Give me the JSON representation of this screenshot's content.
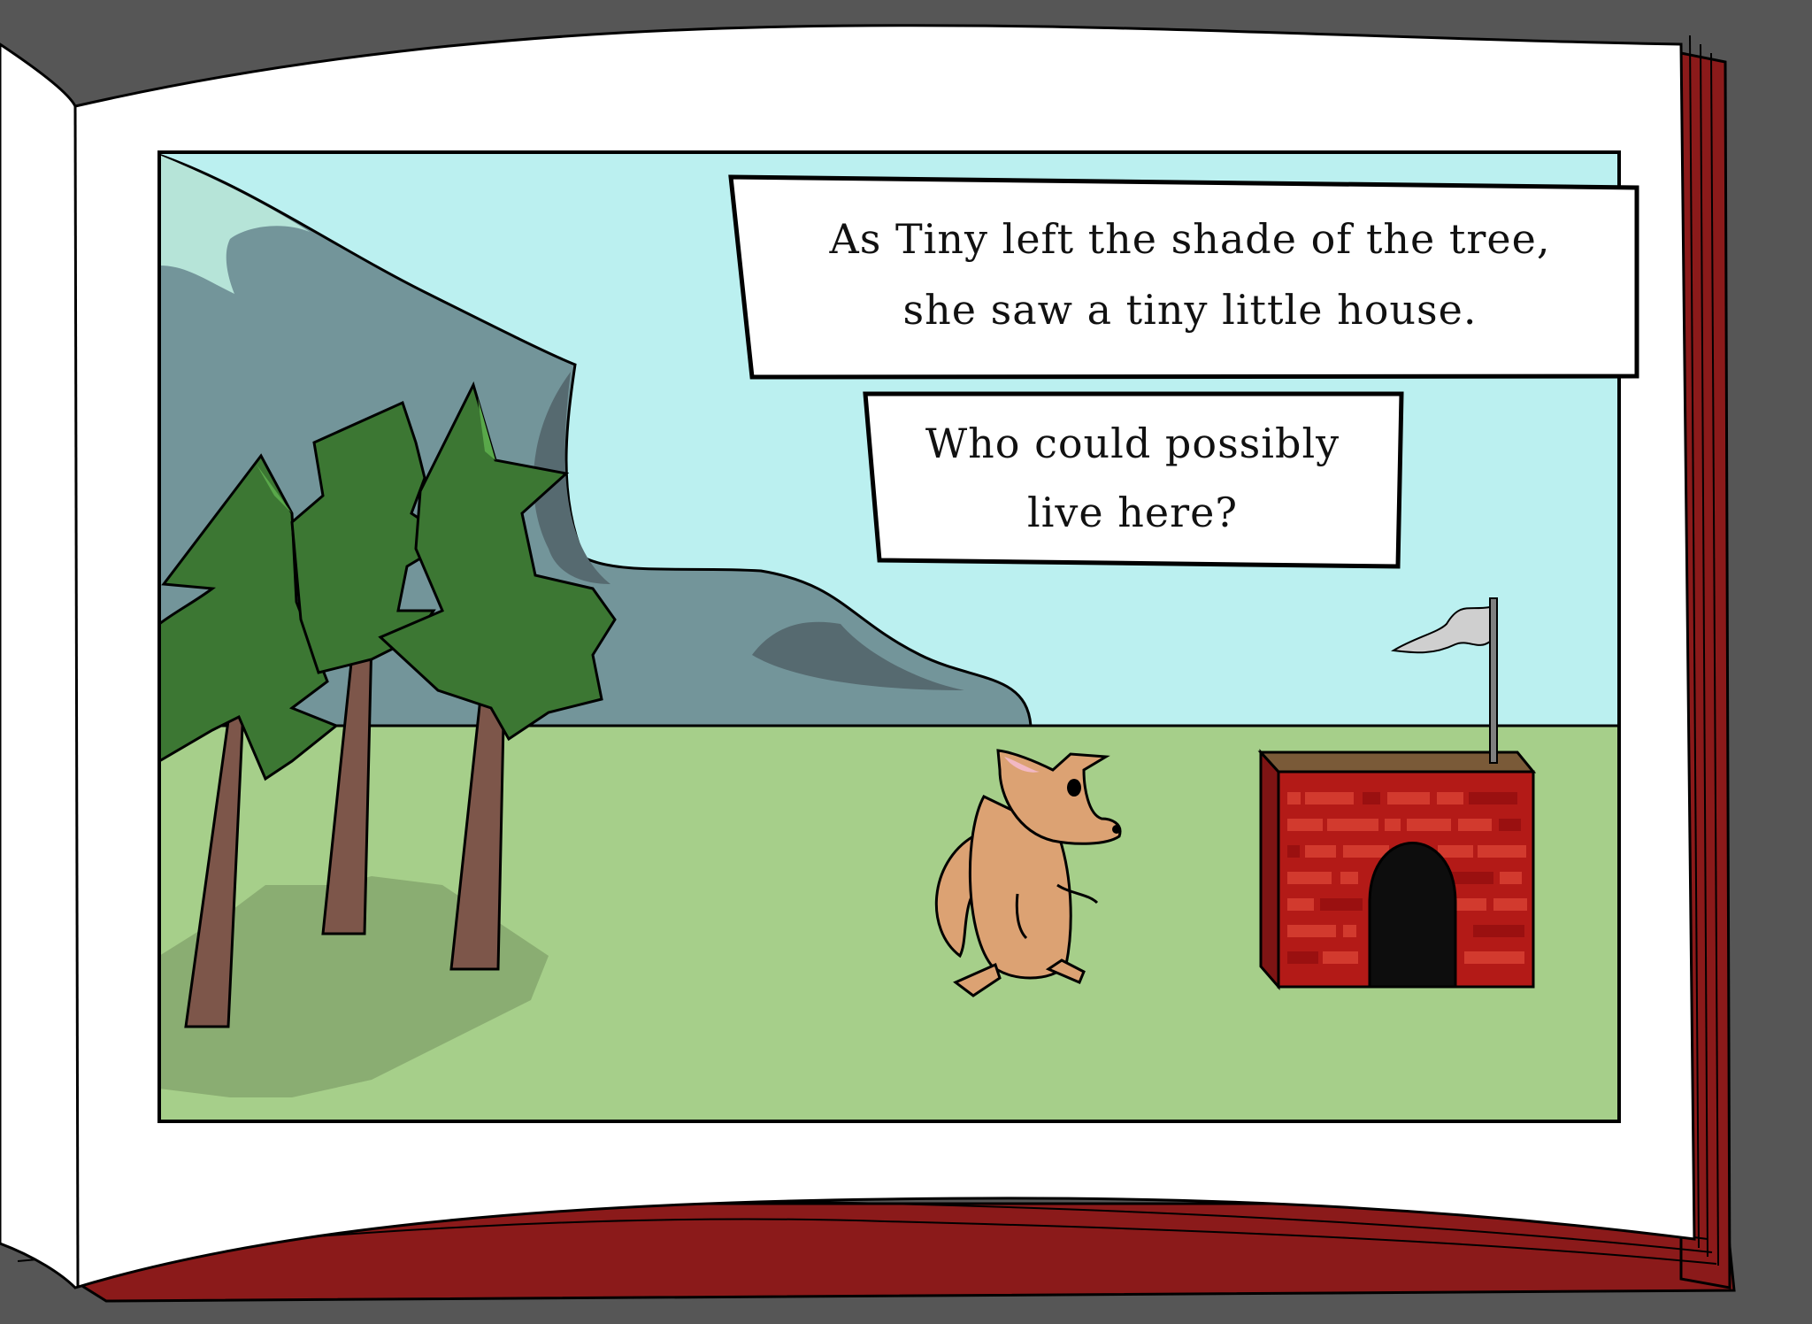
{
  "story": {
    "narration_line_1": "As Tiny left the shade of the tree,",
    "narration_line_2": "she saw a tiny little house.",
    "question_line_1": "Who could possibly",
    "question_line_2": "live here?"
  },
  "colors": {
    "background": "#565656",
    "page": "#ffffff",
    "book_cover": "#8b1a1a",
    "sky": "#bbf0f0",
    "grass": "#a6cf8a",
    "mountain": "#73959a",
    "tree_foliage": "#3c7733",
    "tree_trunk": "#7d564a",
    "brick_house": "#b31a17",
    "fox": "#dca273",
    "flag": "#cfcfcf"
  }
}
